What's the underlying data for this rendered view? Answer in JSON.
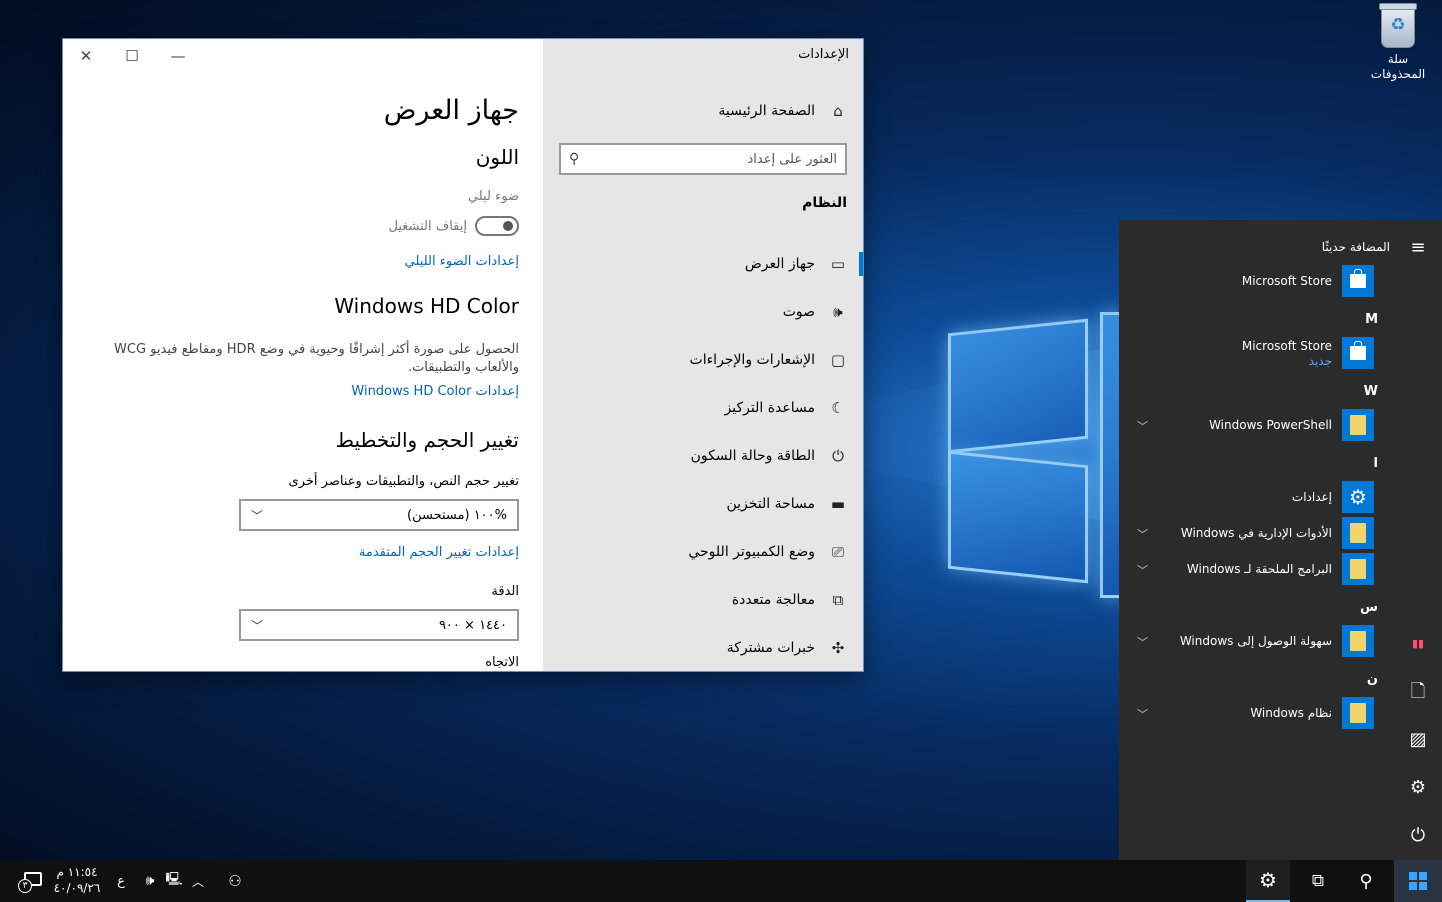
{
  "desktop": {
    "recycle_bin_label": "سلة المحذوفات"
  },
  "settings": {
    "app_title": "الإعدادات",
    "nav": {
      "home": "الصفحة الرئيسية",
      "search_placeholder": "العثور على إعداد",
      "section": "النظام",
      "items": [
        {
          "label": "جهاز العرض",
          "icon": "monitor-icon"
        },
        {
          "label": "صوت",
          "icon": "speaker-icon"
        },
        {
          "label": "الإشعارات والإجراءات",
          "icon": "notification-icon"
        },
        {
          "label": "مساعدة التركيز",
          "icon": "moon-icon"
        },
        {
          "label": "الطاقة وحالة السكون",
          "icon": "power-icon"
        },
        {
          "label": "مساحة التخزين",
          "icon": "storage-icon"
        },
        {
          "label": "وضع الكمبيوتر اللوحي",
          "icon": "tablet-icon"
        },
        {
          "label": "معالجة متعددة",
          "icon": "multitask-icon"
        },
        {
          "label": "خبرات مشتركة",
          "icon": "shared-icon"
        }
      ]
    },
    "content": {
      "title": "جهاز العرض",
      "color_heading": "اللون",
      "night_light_label": "ضوء ليلي",
      "night_light_state": "إيقاف التشغيل",
      "night_light_link": "إعدادات الضوء الليلي",
      "hdr_heading": "Windows HD Color",
      "hdr_description": "الحصول على صورة أكثر إشراقًا وحيوية في وضع HDR ومقاطع فيديو WCG والألعاب والتطبيقات.",
      "hdr_link": "إعدادات Windows HD Color",
      "scale_heading": "تغيير الحجم والتخطيط",
      "scale_label": "تغيير حجم النص، والتطبيقات وعناصر أخرى",
      "scale_value": "%١٠٠ (مستحسن)",
      "advanced_scale_link": "إعدادات تغيير الحجم المتقدمة",
      "resolution_label": "الدقة",
      "resolution_value": "١٤٤٠ × ٩٠٠",
      "orientation_label": "الاتجاه"
    }
  },
  "start_menu": {
    "recent_header": "المضافة حديثًا",
    "apps": [
      {
        "label": "Microsoft Store",
        "tile": "store"
      },
      {
        "letter": "M"
      },
      {
        "label": "Microsoft Store",
        "sub": "جديد",
        "tile": "store"
      },
      {
        "letter": "W"
      },
      {
        "label": "Windows PowerShell",
        "tile": "folder",
        "expandable": true
      },
      {
        "letter": "ا"
      },
      {
        "label": "إعدادات",
        "tile": "gear"
      },
      {
        "label": "الأدوات الإدارية في Windows",
        "tile": "folder",
        "expandable": true
      },
      {
        "label": "البرامج الملحقة لـ Windows",
        "tile": "folder",
        "expandable": true
      },
      {
        "letter": "س"
      },
      {
        "label": "سهولة الوصول إلى Windows",
        "tile": "folder",
        "expandable": true
      },
      {
        "letter": "ن"
      },
      {
        "label": "نظام Windows",
        "tile": "folder",
        "expandable": true
      }
    ],
    "rail_icons": [
      "menu-icon",
      "user-badge-icon",
      "document-icon",
      "pictures-icon",
      "settings-icon",
      "power-icon"
    ]
  },
  "taskbar": {
    "time": "١١:٥٤ م",
    "date": "٤٠/٠٩/٢٦",
    "language": "ع",
    "notification_count": "٣",
    "accent": "#0078d7"
  }
}
